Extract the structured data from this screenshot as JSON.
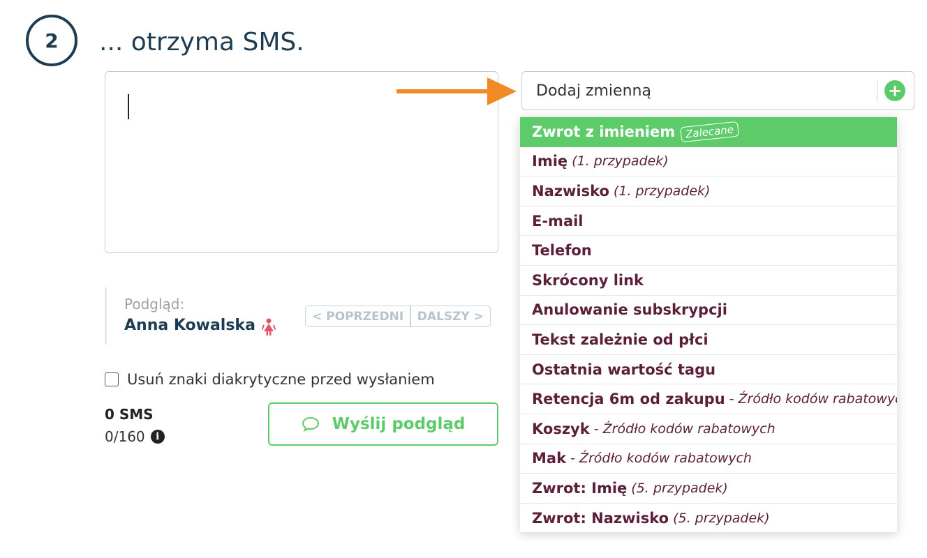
{
  "step": {
    "number": "2",
    "title": "... otrzyma SMS."
  },
  "message": {
    "value": ""
  },
  "variable_select": {
    "label": "Dodaj zmienną",
    "add_icon": "plus-circle-icon"
  },
  "dropdown": {
    "items": [
      {
        "main": "Zwrot z imieniem",
        "sub": "",
        "badge": "Zalecane",
        "active": true
      },
      {
        "main": "Imię",
        "sub": "(1. przypadek)",
        "badge": "",
        "active": false
      },
      {
        "main": "Nazwisko",
        "sub": "(1. przypadek)",
        "badge": "",
        "active": false
      },
      {
        "main": "E-mail",
        "sub": "",
        "badge": "",
        "active": false
      },
      {
        "main": "Telefon",
        "sub": "",
        "badge": "",
        "active": false
      },
      {
        "main": "Skrócony link",
        "sub": "",
        "badge": "",
        "active": false
      },
      {
        "main": "Anulowanie subskrypcji",
        "sub": "",
        "badge": "",
        "active": false
      },
      {
        "main": "Tekst zależnie od płci",
        "sub": "",
        "badge": "",
        "active": false
      },
      {
        "main": "Ostatnia wartość tagu",
        "sub": "",
        "badge": "",
        "active": false
      },
      {
        "main": "Retencja 6m od zakupu",
        "sub": "- Źródło kodów rabatowych",
        "badge": "",
        "active": false
      },
      {
        "main": "Koszyk",
        "sub": "- Źródło kodów rabatowych",
        "badge": "",
        "active": false
      },
      {
        "main": "Mak",
        "sub": "- Źródło kodów rabatowych",
        "badge": "",
        "active": false
      },
      {
        "main": "Zwrot: Imię",
        "sub": "(5. przypadek)",
        "badge": "",
        "active": false
      },
      {
        "main": "Zwrot: Nazwisko",
        "sub": "(5. przypadek)",
        "badge": "",
        "active": false
      }
    ]
  },
  "preview": {
    "label": "Podgląd:",
    "name": "Anna Kowalska",
    "gender_icon": "female-icon",
    "prev_label": "< POPRZEDNI",
    "next_label": "DALSZY >"
  },
  "options": {
    "remove_diacritics_label": "Usuń znaki diakrytyczne przed wysłaniem",
    "remove_diacritics_checked": false
  },
  "counter": {
    "sms": "0 SMS",
    "chars": "0/160"
  },
  "send_preview": {
    "label": "Wyślij podgląd",
    "icon": "chat-bubble-icon"
  },
  "colors": {
    "accent_green": "#5ecb6b",
    "arrow_orange": "#f08a24",
    "heading_navy": "#1d3c52",
    "item_maroon": "#5c1f3a"
  }
}
